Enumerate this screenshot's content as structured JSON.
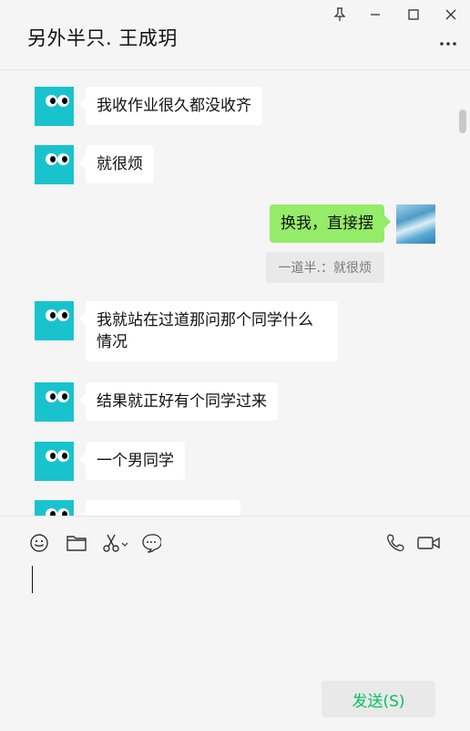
{
  "header": {
    "title": "另外半只. 王成玥"
  },
  "messages": [
    {
      "sender": "other",
      "text": "我收作业很久都没收齐"
    },
    {
      "sender": "other",
      "text": "就很烦"
    },
    {
      "sender": "me",
      "text": "换我，直接摆",
      "quote": "一道半.：就很烦"
    },
    {
      "sender": "other",
      "text": "我就站在过道那问那个同学什么情况"
    },
    {
      "sender": "other",
      "text": "结果就正好有个同学过来"
    },
    {
      "sender": "other",
      "text": "一个男同学"
    }
  ],
  "input": {
    "send_label": "发送(S)"
  },
  "icons": {
    "window": [
      "pin-icon",
      "minimize-icon",
      "maximize-icon",
      "close-icon"
    ],
    "toolbar": [
      "emoji-icon",
      "folder-icon",
      "scissors-icon",
      "chat-history-icon"
    ],
    "call": [
      "phone-icon",
      "video-call-icon"
    ]
  },
  "colors": {
    "accent": "#07c160",
    "my_bubble": "#95ec69",
    "avatar_bg": "#19c3cd"
  }
}
